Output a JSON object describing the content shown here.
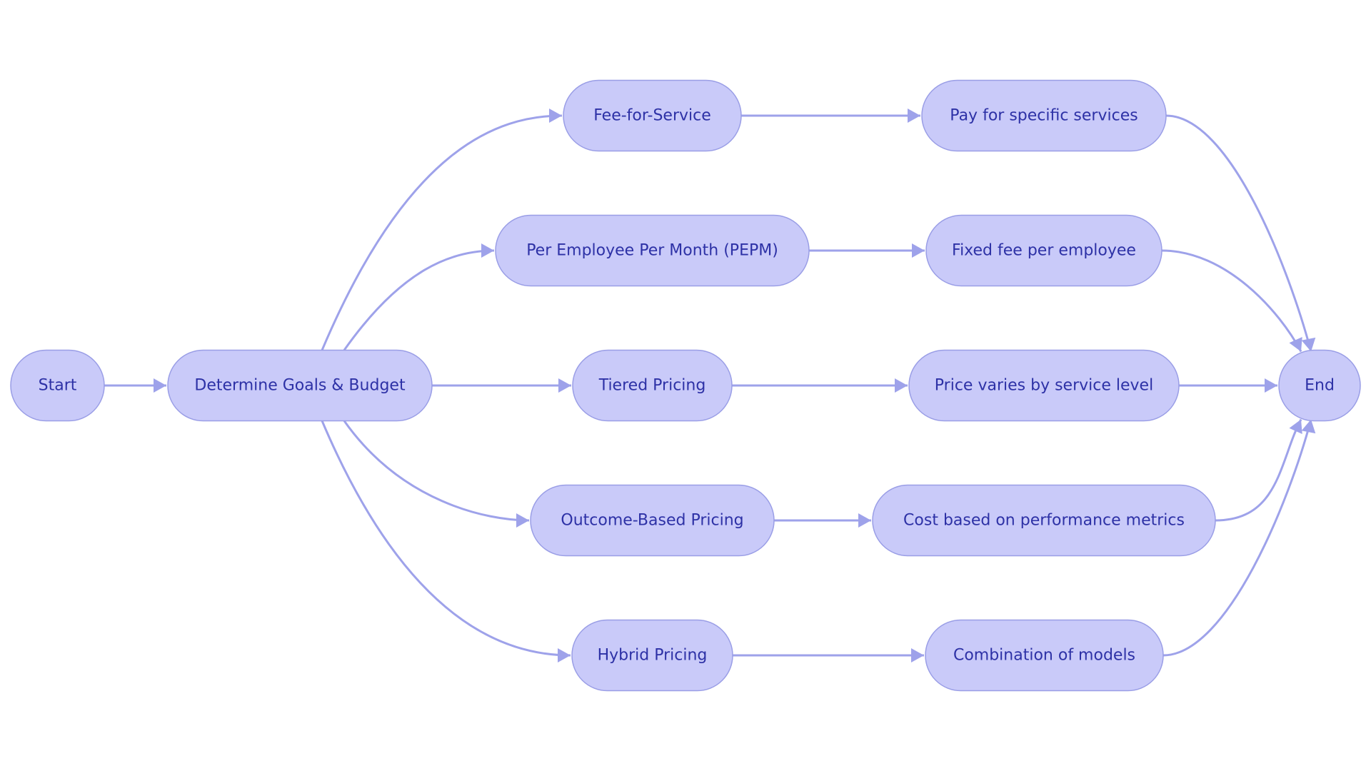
{
  "diagram": {
    "type": "flowchart",
    "direction": "left-to-right",
    "colors": {
      "node_fill": "#c9caf9",
      "node_stroke": "#9a9ee6",
      "node_text": "#2d31a6",
      "edge": "#9ea2ea",
      "background": "#ffffff"
    },
    "nodes": [
      {
        "id": "start",
        "label": "Start"
      },
      {
        "id": "goals",
        "label": "Determine Goals & Budget"
      },
      {
        "id": "ffs",
        "label": "Fee-for-Service"
      },
      {
        "id": "pepm",
        "label": "Per Employee Per Month (PEPM)"
      },
      {
        "id": "tiered",
        "label": "Tiered Pricing"
      },
      {
        "id": "outcome",
        "label": "Outcome-Based Pricing"
      },
      {
        "id": "hybrid",
        "label": "Hybrid Pricing"
      },
      {
        "id": "pay",
        "label": "Pay for specific services"
      },
      {
        "id": "fixed",
        "label": "Fixed fee per employee"
      },
      {
        "id": "price",
        "label": "Price varies by service level"
      },
      {
        "id": "cost",
        "label": "Cost based on performance metrics"
      },
      {
        "id": "combo",
        "label": "Combination of models"
      },
      {
        "id": "end",
        "label": "End"
      }
    ],
    "edges": [
      {
        "from": "start",
        "to": "goals"
      },
      {
        "from": "goals",
        "to": "ffs"
      },
      {
        "from": "goals",
        "to": "pepm"
      },
      {
        "from": "goals",
        "to": "tiered"
      },
      {
        "from": "goals",
        "to": "outcome"
      },
      {
        "from": "goals",
        "to": "hybrid"
      },
      {
        "from": "ffs",
        "to": "pay"
      },
      {
        "from": "pepm",
        "to": "fixed"
      },
      {
        "from": "tiered",
        "to": "price"
      },
      {
        "from": "outcome",
        "to": "cost"
      },
      {
        "from": "hybrid",
        "to": "combo"
      },
      {
        "from": "pay",
        "to": "end"
      },
      {
        "from": "fixed",
        "to": "end"
      },
      {
        "from": "price",
        "to": "end"
      },
      {
        "from": "cost",
        "to": "end"
      },
      {
        "from": "combo",
        "to": "end"
      }
    ]
  }
}
